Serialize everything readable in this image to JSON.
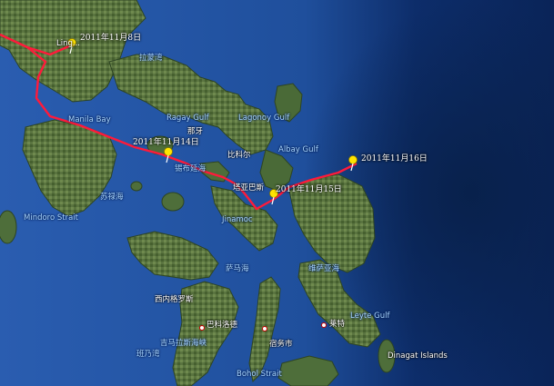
{
  "colors": {
    "ocean_deep": "#0a2a66",
    "ocean_light": "#2a5fb0",
    "land": "#4f6d3c",
    "land_dark": "#33492a",
    "route": "#ff1a3a",
    "pin": "#ffe400"
  },
  "track_pins": [
    {
      "label": "2011年11月8日",
      "icon": "yellow-pushpin-icon"
    },
    {
      "label": "2011年11月14日",
      "icon": "yellow-pushpin-icon"
    },
    {
      "label": "2011年11月15日",
      "icon": "yellow-pushpin-icon"
    },
    {
      "label": "2011年11月16日",
      "icon": "yellow-pushpin-icon"
    }
  ],
  "labels": {
    "lingayen": "Ling...",
    "manila_bay": "Manila Bay",
    "lamon_bay": "拉蒙湾",
    "ragay_gulf": "Ragay Gulf",
    "lagonoy_gulf": "Lagonoy Gulf",
    "naga": "那牙",
    "sibuyan_sea": "锡布延海",
    "albay_gulf": "Albay Gulf",
    "bicol": "比科尔",
    "tayabas": "塔亚巴斯",
    "mindoro_strait": "Mindoro Strait",
    "sulu_sea": "苏禄海",
    "samar_sea": "萨马海",
    "leyte_gulf": "Leyte Gulf",
    "visayan_sea": "维萨亚海",
    "negros_west": "西内格罗斯",
    "bacolod": "巴科洛德",
    "guimaras": "吉马拉斯海峡",
    "panay_gulf": "班乃湾",
    "cebu": "宿务市",
    "bohol_strait": "Bohol Strait",
    "dinagat": "Dinagat Islands",
    "leyte": "莱特",
    "jinamoc": "Jinamoc"
  }
}
